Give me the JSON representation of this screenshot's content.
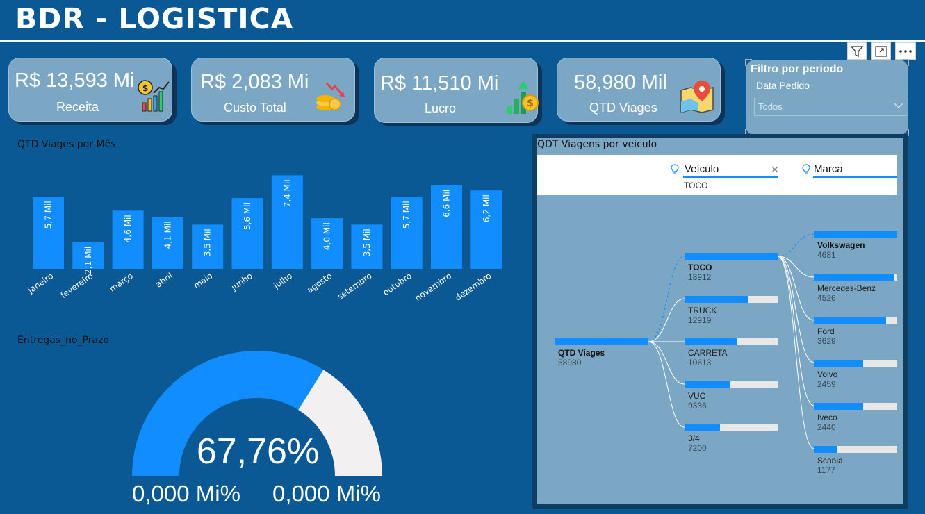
{
  "header": {
    "title": "BDR - LOGISTICA"
  },
  "kpis": [
    {
      "value": "R$ 13,593 Mi",
      "label": "Receita",
      "icon": "revenue-chart-icon"
    },
    {
      "value": "R$ 2,083 Mi",
      "label": "Custo Total",
      "icon": "cost-coins-icon"
    },
    {
      "value": "R$ 11,510 Mi",
      "label": "Lucro",
      "icon": "profit-growth-icon"
    },
    {
      "value": "58,980 Mil",
      "label": "QTD Viages",
      "icon": "map-pin-icon"
    }
  ],
  "visual_header": {
    "icons": [
      "filter-icon",
      "focus-mode-icon",
      "more-options-icon"
    ]
  },
  "slicer": {
    "title": "Filtro por periodo",
    "field": "Data Pedido",
    "selected": "Todos"
  },
  "bar_chart": {
    "title": "QTD Viages por Mês",
    "chart_data": {
      "type": "bar",
      "categories": [
        "janeiro",
        "fevereiro",
        "março",
        "abril",
        "maio",
        "junho",
        "julho",
        "agosto",
        "setembro",
        "outubro",
        "novembro",
        "dezembro"
      ],
      "values": [
        5.7,
        2.1,
        4.6,
        4.1,
        3.5,
        5.6,
        7.4,
        4.0,
        3.5,
        5.7,
        6.6,
        6.2
      ],
      "data_labels": [
        "5,7 Mil",
        "2,1 Mil",
        "4,6 Mil",
        "4,1 Mil",
        "3,5 Mil",
        "5,6 Mil",
        "7,4 Mil",
        "4,0 Mil",
        "3,5 Mil",
        "5,7 Mil",
        "6,6 Mil",
        "6,2 Mil"
      ],
      "unit": "Mil",
      "color": "#118dff"
    }
  },
  "gauge": {
    "title": "Entregas_no_Prazo",
    "chart_data": {
      "type": "gauge",
      "value": 67.76,
      "value_label": "67,76%",
      "min_label": "0,000 Mi%",
      "max_label": "0,000 Mi%",
      "fill_color": "#118dff",
      "track_color": "#f2f0f0"
    }
  },
  "decomposition": {
    "title": "QDT Viagens por veiculo",
    "levels": [
      {
        "label": "Veículo",
        "selected": "TOCO",
        "icon": "lightbulb-icon",
        "close_icon": "close-icon"
      },
      {
        "label": "Marca",
        "icon": "lightbulb-icon"
      }
    ],
    "root": {
      "label": "QTD Viages",
      "value": "58980",
      "share": 1.0
    },
    "vehicles": [
      {
        "label": "TOCO",
        "value": "18912",
        "share": 1.0,
        "selected": true
      },
      {
        "label": "TRUCK",
        "value": "12919",
        "share": 0.68
      },
      {
        "label": "CARRETA",
        "value": "10613",
        "share": 0.56
      },
      {
        "label": "VUC",
        "value": "9336",
        "share": 0.49
      },
      {
        "label": "3/4",
        "value": "7200",
        "share": 0.38
      }
    ],
    "brands": [
      {
        "label": "Volkswagen",
        "value": "4681",
        "share": 1.0,
        "bold": true
      },
      {
        "label": "Mercedes-Benz",
        "value": "4526",
        "share": 0.97
      },
      {
        "label": "Ford",
        "value": "3629",
        "share": 0.87
      },
      {
        "label": "Volvo",
        "value": "2459",
        "share": 0.59
      },
      {
        "label": "Iveco",
        "value": "2440",
        "share": 0.59
      },
      {
        "label": "Scania",
        "value": "1177",
        "share": 0.28
      }
    ]
  }
}
